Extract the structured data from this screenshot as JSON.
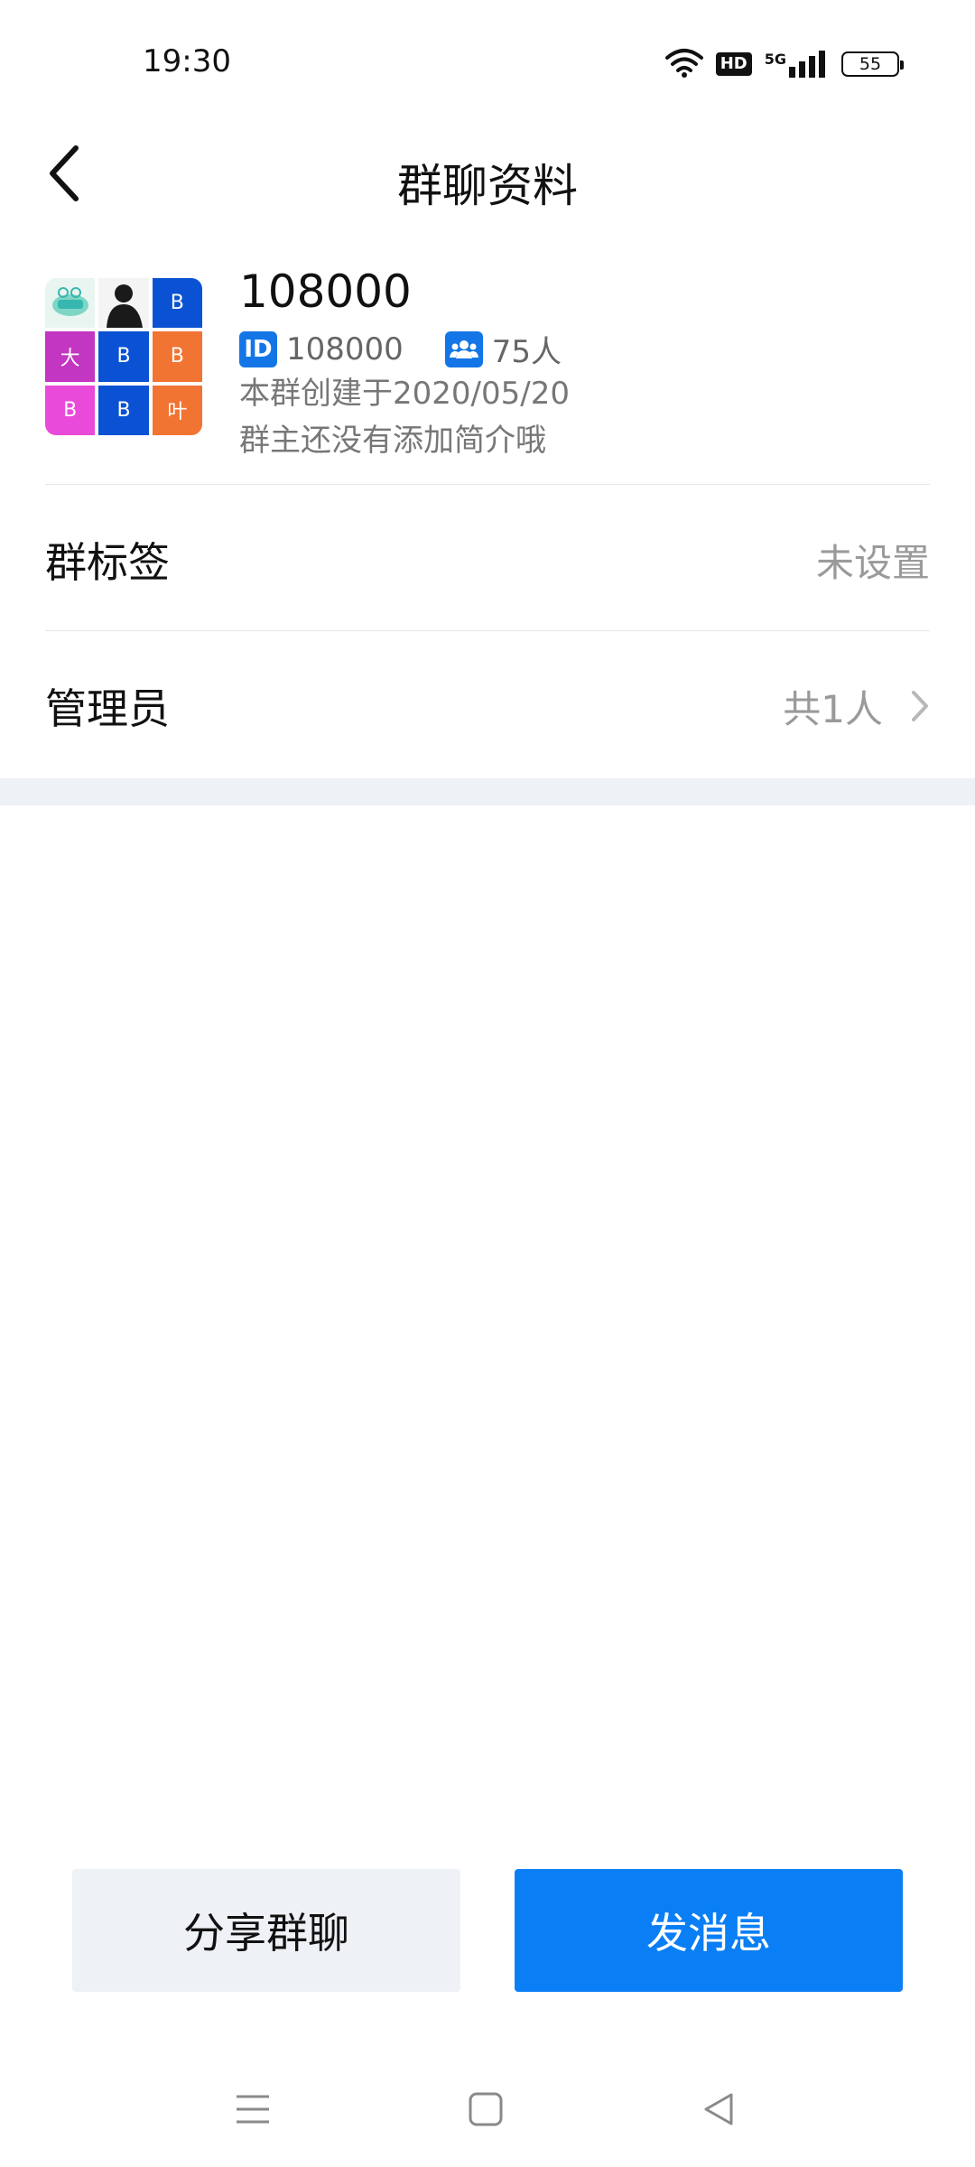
{
  "status_bar": {
    "time": "19:30",
    "hd_label": "HD",
    "network_label": "5G",
    "battery_level": "55"
  },
  "header": {
    "title": "群聊资料",
    "back_icon": "chevron-left-icon"
  },
  "group": {
    "name": "108000",
    "id_badge": "ID",
    "id": "108000",
    "member_count": "75人",
    "created": "本群创建于2020/05/20",
    "intro": "群主还没有添加简介哦",
    "avatar_tiles": [
      "",
      "",
      "B",
      "大",
      "B",
      "B",
      "B",
      "B",
      "叶"
    ]
  },
  "rows": {
    "tag_label": "群标签",
    "tag_value": "未设置",
    "admin_label": "管理员",
    "admin_value": "共1人"
  },
  "actions": {
    "share_label": "分享群聊",
    "send_label": "发消息"
  },
  "colors": {
    "primary": "#0a7ff5",
    "badge_blue": "#1476e6",
    "secondary_bg": "#eef1f5"
  }
}
